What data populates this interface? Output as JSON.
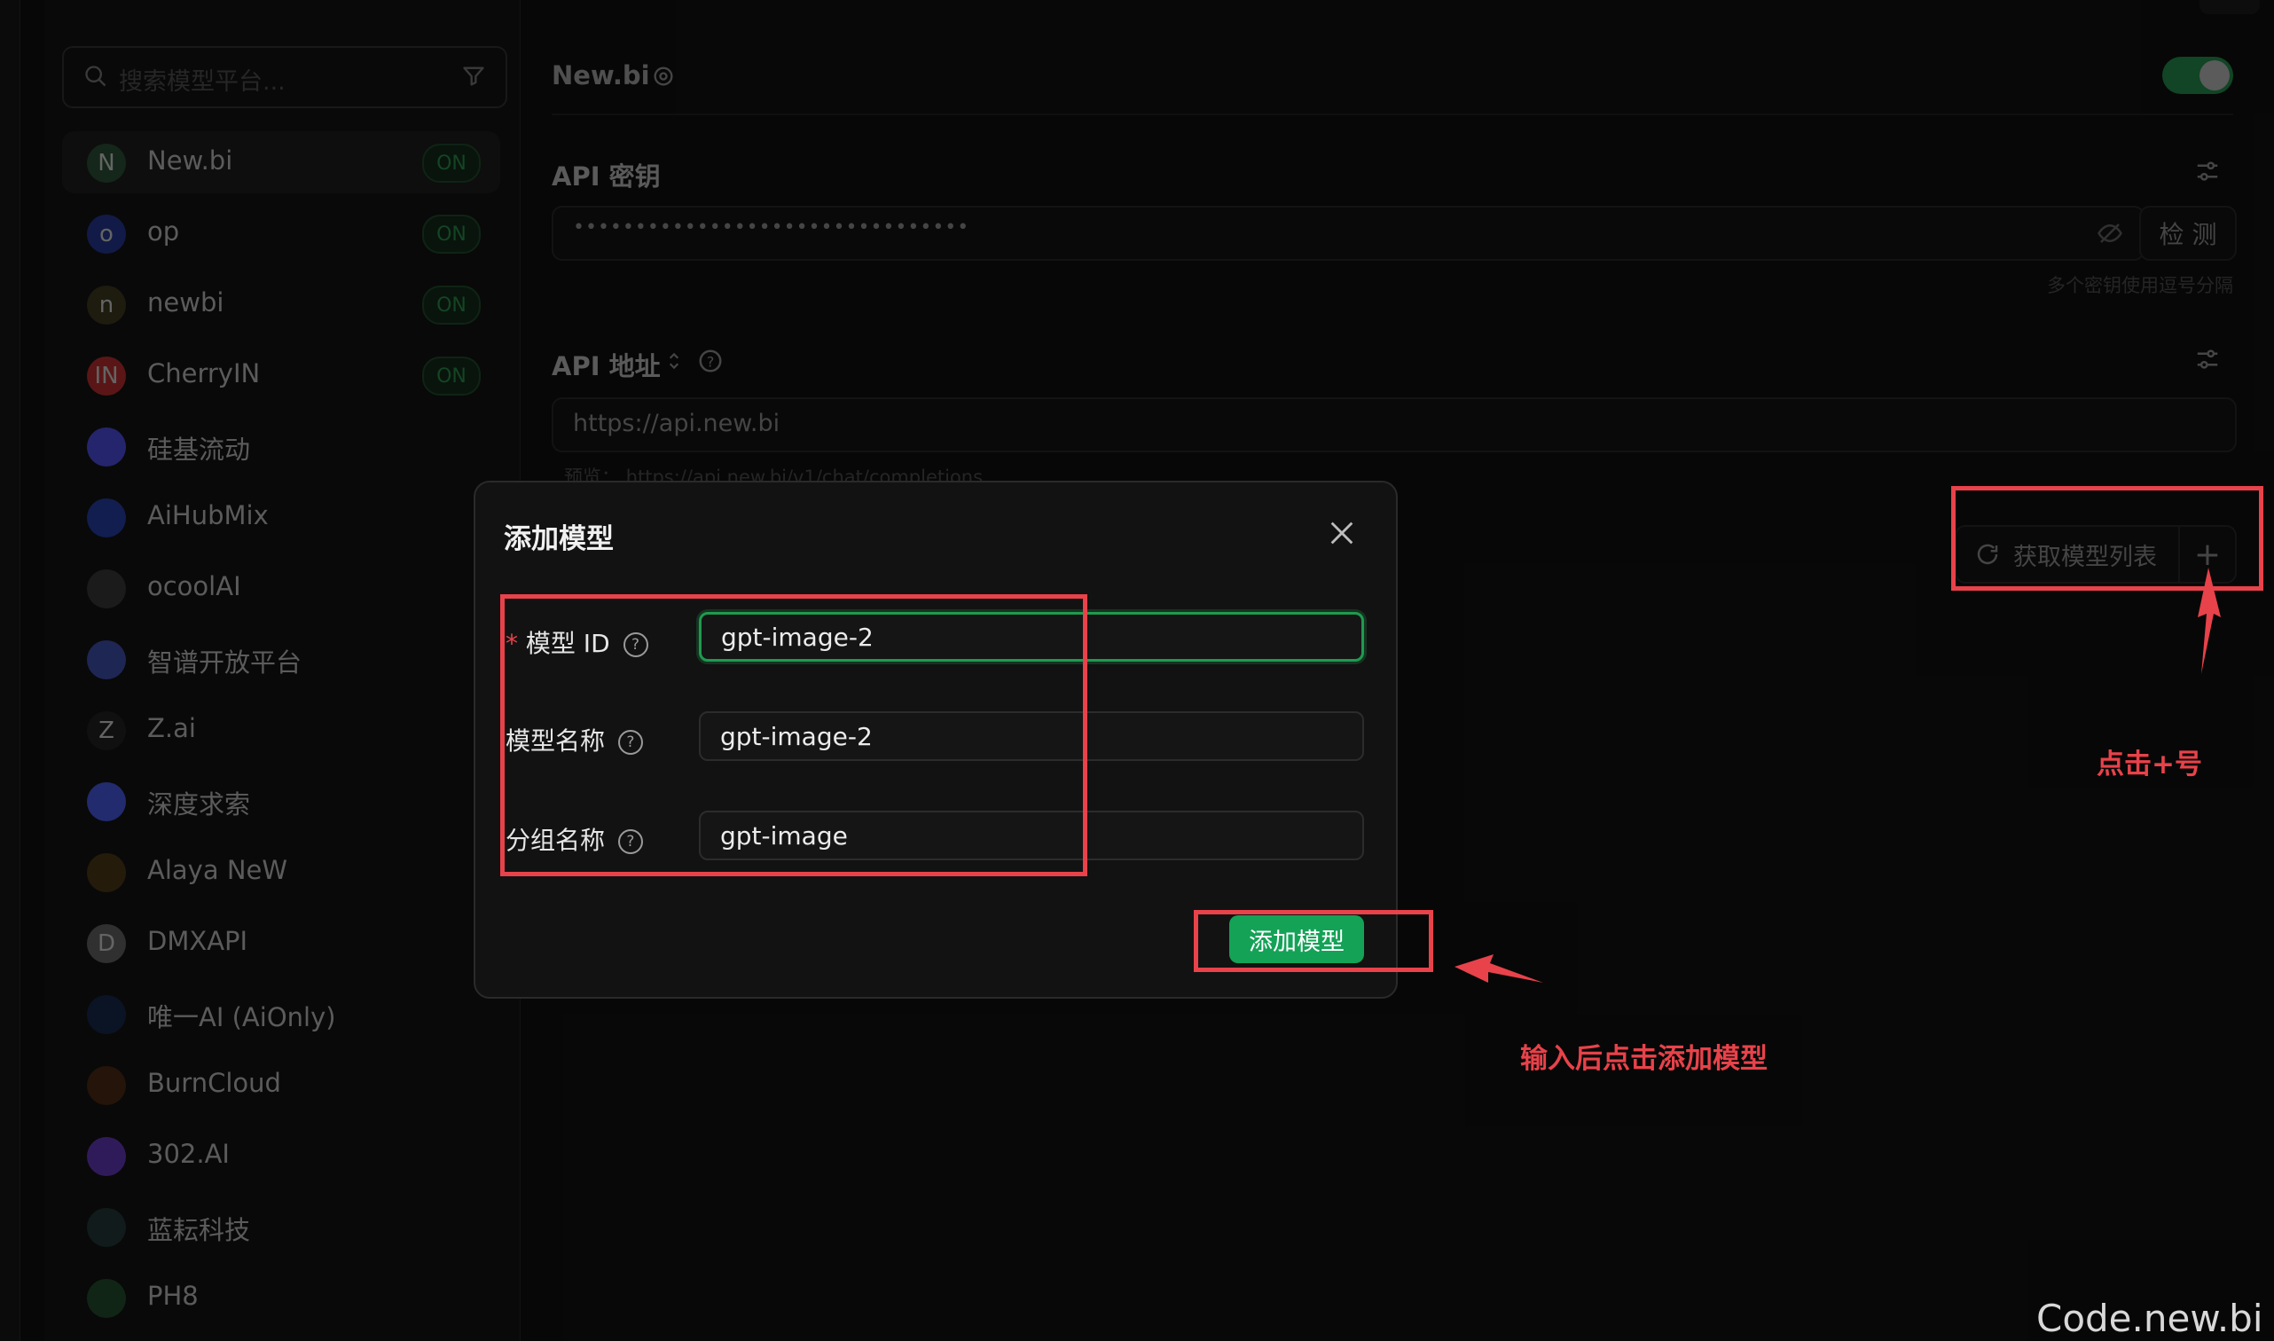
{
  "sidebar": {
    "search_placeholder": "搜索模型平台...",
    "providers": [
      {
        "name": "New.bi",
        "avatar": "N",
        "avatar_color": "#1f3d28",
        "on": "ON",
        "active": true
      },
      {
        "name": "op",
        "avatar": "o",
        "avatar_color": "#1d2a6e",
        "on": "ON"
      },
      {
        "name": "newbi",
        "avatar": "n",
        "avatar_color": "#2e2a18",
        "on": "ON"
      },
      {
        "name": "CherryIN",
        "avatar": "IN",
        "avatar_color": "#8a2323",
        "on": "ON"
      },
      {
        "name": "硅基流动",
        "avatar": "",
        "avatar_color": "#3a3aa8"
      },
      {
        "name": "AiHubMix",
        "avatar": "",
        "avatar_color": "#1d2f7a"
      },
      {
        "name": "ocoolAI",
        "avatar": "",
        "avatar_color": "#2a2a2a"
      },
      {
        "name": "智谱开放平台",
        "avatar": "",
        "avatar_color": "#2f3b82"
      },
      {
        "name": "Z.ai",
        "avatar": "Z",
        "avatar_color": "#1a1a1a"
      },
      {
        "name": "深度求索",
        "avatar": "",
        "avatar_color": "#3343a8"
      },
      {
        "name": "Alaya NeW",
        "avatar": "",
        "avatar_color": "#3a2a12"
      },
      {
        "name": "DMXAPI",
        "avatar": "D",
        "avatar_color": "#4a4a4a"
      },
      {
        "name": "唯一AI (AiOnly)",
        "avatar": "",
        "avatar_color": "#12203a"
      },
      {
        "name": "BurnCloud",
        "avatar": "",
        "avatar_color": "#3a200e"
      },
      {
        "name": "302.AI",
        "avatar": "",
        "avatar_color": "#4b2a8a"
      },
      {
        "name": "蓝耘科技",
        "avatar": "",
        "avatar_color": "#1b2a2a"
      },
      {
        "name": "PH8",
        "avatar": "",
        "avatar_color": "#1a3a22"
      }
    ]
  },
  "provider": {
    "title": "New.bi",
    "api_key_label": "API 密钥",
    "api_key_value": "••••••••••••••••••••••••••••••••",
    "check_label": "检 测",
    "key_hint": "多个密钥使用逗号分隔",
    "api_url_label": "API 地址",
    "api_url_value": "https://api.new.bi",
    "preview_prefix": "预览：",
    "preview_url": "https://api.new.bi/v1/chat/completions",
    "fetch_models_label": "获取模型列表",
    "add_symbol": "+"
  },
  "modal": {
    "title": "添加模型",
    "model_id_label": "模型 ID",
    "model_id_value": "gpt-image-2",
    "model_name_label": "模型名称",
    "model_name_value": "gpt-image-2",
    "group_name_label": "分组名称",
    "group_name_value": "gpt-image",
    "required_mark": "*",
    "submit_label": "添加模型"
  },
  "annotations": {
    "click_plus": "点击+号",
    "input_then_add": "输入后点击添加模型",
    "accent_color": "#e8424a"
  },
  "watermark": "Code.new.bi"
}
